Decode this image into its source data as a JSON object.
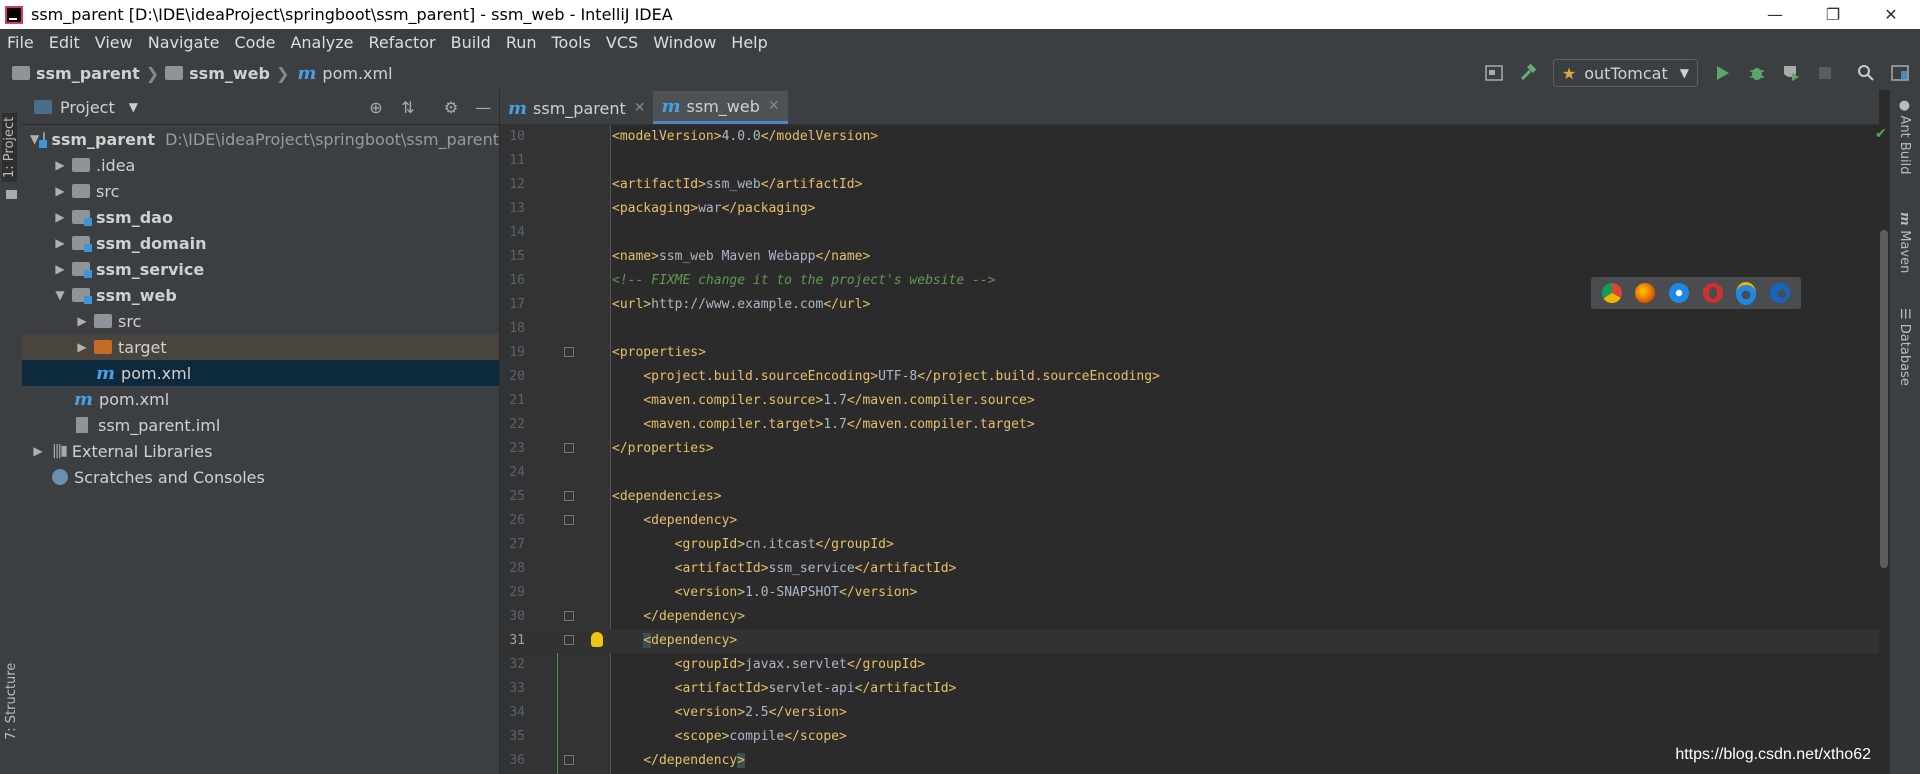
{
  "window": {
    "title": "ssm_parent [D:\\IDE\\ideaProject\\springboot\\ssm_parent] - ssm_web - IntelliJ IDEA",
    "controls": [
      "minimize-icon",
      "restore-icon",
      "close-icon"
    ]
  },
  "menu": [
    "File",
    "Edit",
    "View",
    "Navigate",
    "Code",
    "Analyze",
    "Refactor",
    "Build",
    "Run",
    "Tools",
    "VCS",
    "Window",
    "Help"
  ],
  "breadcrumb": [
    "ssm_parent",
    "ssm_web",
    "pom.xml"
  ],
  "run_config": "outTomcat",
  "left_strip": {
    "project": "1: Project",
    "structure": "7: Structure"
  },
  "right_strip": [
    "Ant Build",
    "Maven",
    "Database"
  ],
  "project_panel": {
    "title": "Project",
    "tree": [
      {
        "label": "ssm_parent",
        "path": "D:\\IDE\\ideaProject\\springboot\\ssm_parent"
      },
      {
        "label": ".idea"
      },
      {
        "label": "src"
      },
      {
        "label": "ssm_dao"
      },
      {
        "label": "ssm_domain"
      },
      {
        "label": "ssm_service"
      },
      {
        "label": "ssm_web"
      },
      {
        "label": "src"
      },
      {
        "label": "target"
      },
      {
        "label": "pom.xml"
      },
      {
        "label": "pom.xml"
      },
      {
        "label": "ssm_parent.iml"
      },
      {
        "label": "External Libraries"
      },
      {
        "label": "Scratches and Consoles"
      }
    ]
  },
  "editor_tabs": [
    {
      "label": "ssm_parent",
      "active": false
    },
    {
      "label": "ssm_web",
      "active": true
    }
  ],
  "code": {
    "line_numbers": [
      "10",
      "11",
      "12",
      "13",
      "14",
      "15",
      "16",
      "17",
      "18",
      "19",
      "20",
      "21",
      "22",
      "23",
      "24",
      "25",
      "26",
      "27",
      "28",
      "29",
      "30",
      "31",
      "32",
      "33",
      "34",
      "35",
      "36"
    ],
    "current_line": "31"
  },
  "colors": {
    "background": "#2b2b2b",
    "panel": "#3c3f41",
    "tag": "#e8bf6a",
    "comment": "#629755",
    "selection": "#0d293e"
  },
  "watermark": "https://blog.csdn.net/xtho62"
}
